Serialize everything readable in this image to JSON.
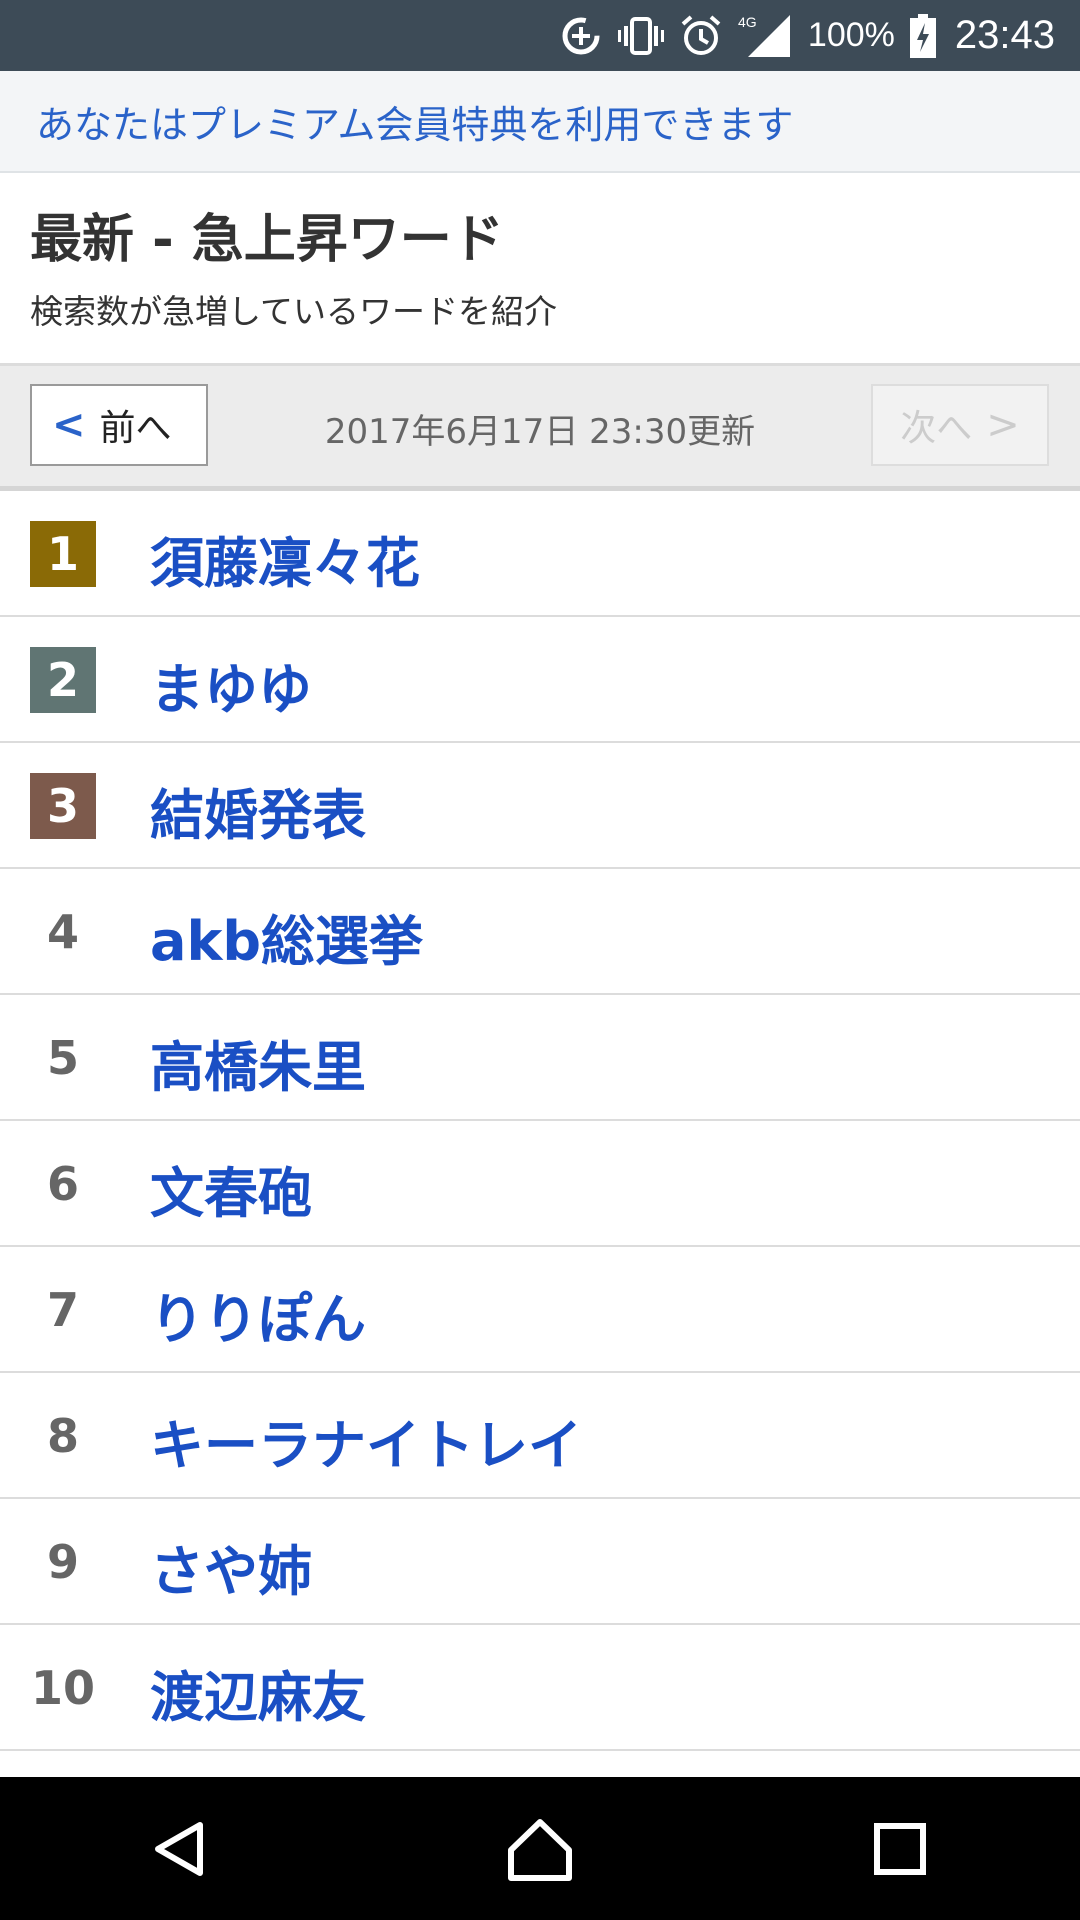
{
  "status_bar": {
    "network": "4G",
    "battery": "100%",
    "time": "23:43"
  },
  "banner": {
    "text": "あなたはプレミアム会員特典を利用できます"
  },
  "header": {
    "title": "最新 - 急上昇ワード",
    "subtitle": "検索数が急増しているワードを紹介"
  },
  "pager": {
    "prev_chevron": "<",
    "prev_label": "前へ",
    "updated": "2017年6月17日 23:30更新",
    "next_label": "次へ",
    "next_chevron": ">"
  },
  "colors": {
    "rank1": "#8a6a06",
    "rank2": "#607573",
    "rank3": "#7d5a4c",
    "link": "#1a4fc4",
    "status_bar": "#3d4b57"
  },
  "ranking": [
    {
      "rank": "1",
      "word": "須藤凜々花"
    },
    {
      "rank": "2",
      "word": "まゆゆ"
    },
    {
      "rank": "3",
      "word": "結婚発表"
    },
    {
      "rank": "4",
      "word": "akb総選挙"
    },
    {
      "rank": "5",
      "word": "高橋朱里"
    },
    {
      "rank": "6",
      "word": "文春砲"
    },
    {
      "rank": "7",
      "word": "りりぽん"
    },
    {
      "rank": "8",
      "word": "キーラナイトレイ"
    },
    {
      "rank": "9",
      "word": "さや姉"
    },
    {
      "rank": "10",
      "word": "渡辺麻友"
    }
  ],
  "nav": {
    "back_icon": "back-triangle-icon",
    "home_icon": "home-icon",
    "recents_icon": "recents-square-icon"
  }
}
